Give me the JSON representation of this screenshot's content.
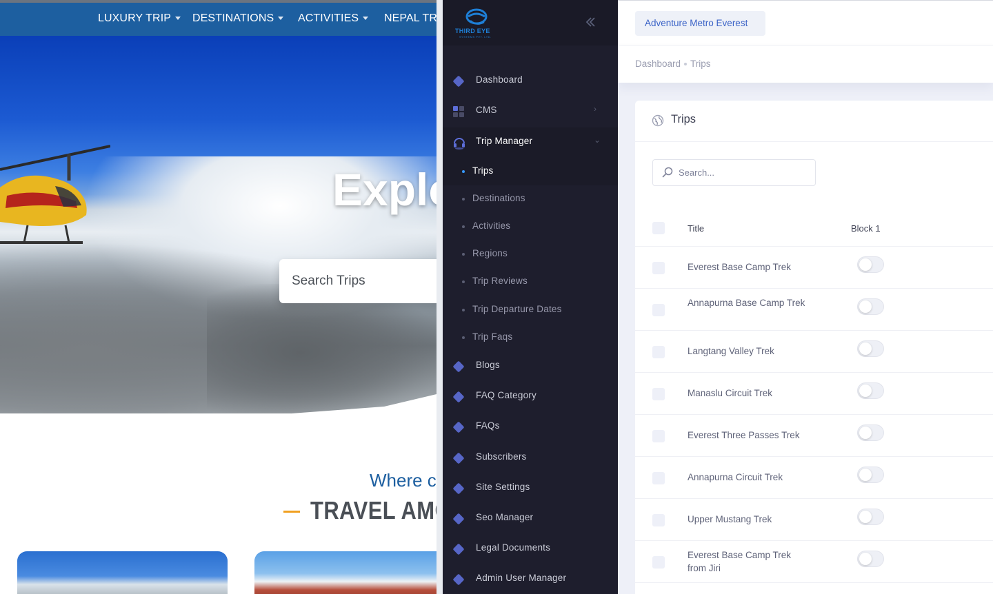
{
  "site": {
    "nav": [
      {
        "label": "LUXURY TRIP"
      },
      {
        "label": "DESTINATIONS"
      },
      {
        "label": "ACTIVITIES"
      },
      {
        "label": "NEPAL TRE"
      }
    ],
    "hero_title": "Explo",
    "search_placeholder": "Search Trips",
    "section_subtitle": "Where c",
    "section_title": "TRAVEL AMC"
  },
  "sidebar": {
    "logo_text": "THIRD EYE",
    "logo_subtext": "SYSTEMS PVT. LTD.",
    "collapse_icon": "double-chevron-left-icon",
    "items": [
      {
        "label": "Dashboard",
        "icon": "diamond-icon"
      },
      {
        "label": "CMS",
        "icon": "grid-icon"
      },
      {
        "label": "Trip Manager",
        "icon": "headset-icon"
      }
    ],
    "trip_manager_children": [
      {
        "label": "Trips"
      },
      {
        "label": "Destinations"
      },
      {
        "label": "Activities"
      },
      {
        "label": "Regions"
      },
      {
        "label": "Trip Reviews"
      },
      {
        "label": "Trip Departure Dates"
      },
      {
        "label": "Trip Faqs"
      }
    ],
    "lower_items": [
      {
        "label": "Blogs"
      },
      {
        "label": "FAQ Category"
      },
      {
        "label": "FAQs"
      },
      {
        "label": "Subscribers"
      },
      {
        "label": "Site Settings"
      },
      {
        "label": "Seo Manager"
      },
      {
        "label": "Legal Documents"
      },
      {
        "label": "Admin User Manager"
      }
    ]
  },
  "header": {
    "site_button": "Adventure Metro Everest"
  },
  "breadcrumb": {
    "root": "Dashboard",
    "current": "Trips"
  },
  "card": {
    "title": "Trips",
    "search_placeholder": "Search...",
    "columns": {
      "title": "Title",
      "block": "Block 1"
    },
    "rows": [
      {
        "title": "Everest Base Camp Trek",
        "blocked": false
      },
      {
        "title": "Annapurna Base Camp Trek",
        "blocked": false
      },
      {
        "title": "Langtang Valley Trek",
        "blocked": false
      },
      {
        "title": "Manaslu Circuit Trek",
        "blocked": false
      },
      {
        "title": "Everest Three Passes Trek",
        "blocked": false
      },
      {
        "title": "Annapurna Circuit Trek",
        "blocked": false
      },
      {
        "title": "Upper Mustang Trek",
        "blocked": false
      },
      {
        "title": "Everest Base Camp Trek from Jiri",
        "blocked": false
      }
    ]
  },
  "colors": {
    "nav_bg": "#1d5fa0",
    "sidebar_bg": "#1e1e2d",
    "accent": "#3699ff",
    "site_button_text": "#3b63c7"
  }
}
